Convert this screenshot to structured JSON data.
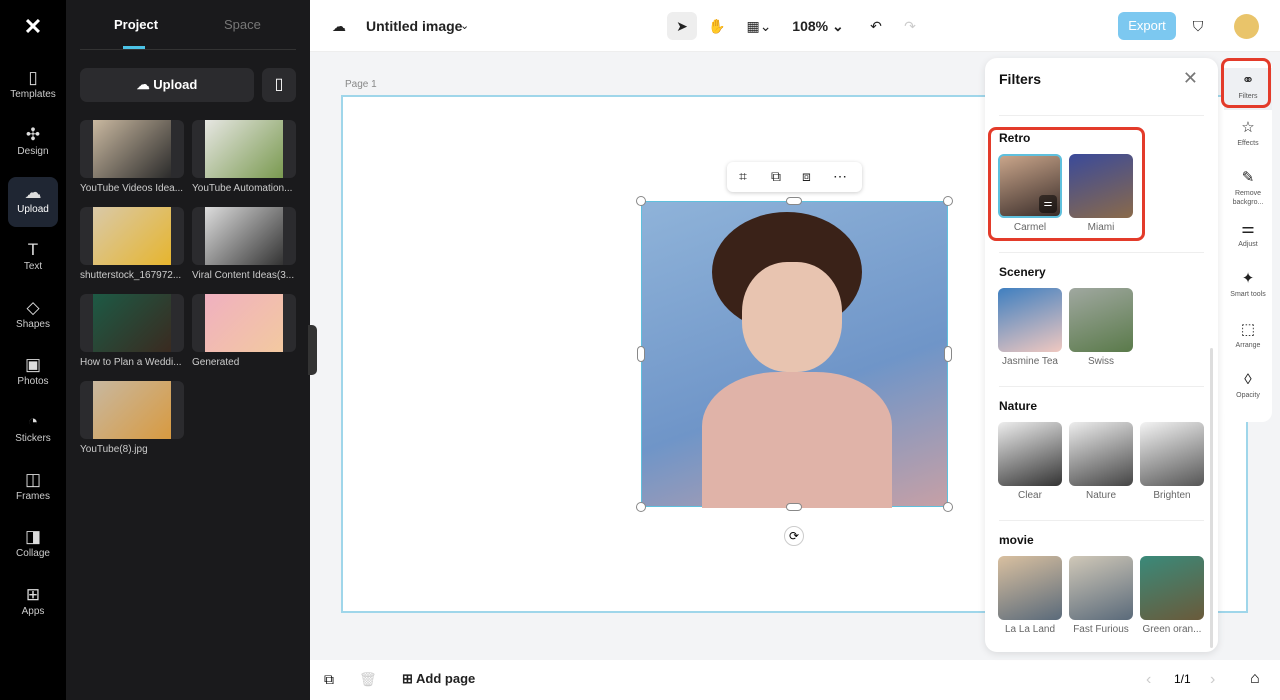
{
  "rail": [
    {
      "label": "Templates",
      "icon": "▯"
    },
    {
      "label": "Design",
      "icon": "✣"
    },
    {
      "label": "Upload",
      "icon": "☁"
    },
    {
      "label": "Text",
      "icon": "T"
    },
    {
      "label": "Shapes",
      "icon": "◇"
    },
    {
      "label": "Photos",
      "icon": "▣"
    },
    {
      "label": "Stickers",
      "icon": "◔"
    },
    {
      "label": "Frames",
      "icon": "◫"
    },
    {
      "label": "Collage",
      "icon": "◨"
    },
    {
      "label": "Apps",
      "icon": "⊞"
    }
  ],
  "panel": {
    "tabs": [
      "Project",
      "Space"
    ],
    "upload": "Upload",
    "items": [
      "YouTube Videos Idea...",
      "YouTube Automation...",
      "shutterstock_167972...",
      "Viral Content Ideas(3...",
      "How to Plan a Weddi...",
      "Generated",
      "YouTube(8).jpg"
    ]
  },
  "topbar": {
    "title": "Untitled image",
    "zoom": "108%",
    "export": "Export"
  },
  "canvas": {
    "page_label": "Page 1"
  },
  "bottom": {
    "add_page": "Add page",
    "page_count": "1/1"
  },
  "filters": {
    "title": "Filters",
    "sections": [
      {
        "name": "Retro",
        "items": [
          "Carmel",
          "Miami"
        ]
      },
      {
        "name": "Scenery",
        "items": [
          "Jasmine Tea",
          "Swiss"
        ]
      },
      {
        "name": "Nature",
        "items": [
          "Clear",
          "Nature",
          "Brighten"
        ]
      },
      {
        "name": "movie",
        "items": [
          "La La Land",
          "Fast Furious",
          "Green oran..."
        ]
      }
    ]
  },
  "tools": [
    {
      "label": "Filters",
      "icon": "⚭"
    },
    {
      "label": "Effects",
      "icon": "☆"
    },
    {
      "label": "Remove backgro...",
      "icon": "✎"
    },
    {
      "label": "Adjust",
      "icon": "⚌"
    },
    {
      "label": "Smart tools",
      "icon": "✦"
    },
    {
      "label": "Arrange",
      "icon": "⬚"
    },
    {
      "label": "Opacity",
      "icon": "◊"
    }
  ]
}
